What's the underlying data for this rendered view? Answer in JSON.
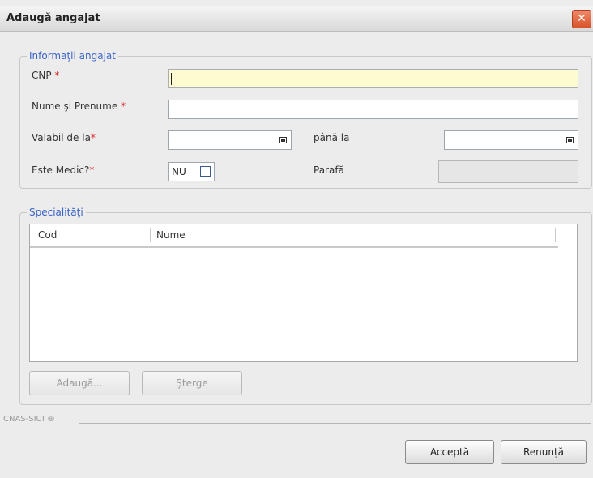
{
  "window": {
    "title": "Adaugă angajat",
    "close_glyph": "✕"
  },
  "employee_info": {
    "legend": "Informaţii angajat",
    "cnp_label": "CNP",
    "cnp_value": "",
    "name_label": "Nume şi Prenume",
    "name_value": "",
    "valid_from_label": "Valabil de la",
    "valid_from_value": "",
    "valid_to_label": "până la",
    "valid_to_value": "",
    "is_medic_label": "Este Medic?",
    "is_medic_value": "NU",
    "is_medic_checked": false,
    "parafa_label": "Parafă",
    "parafa_value": "",
    "required_mark": "*"
  },
  "specialties": {
    "legend": "Specialităţi",
    "columns": [
      "Cod",
      "Nume"
    ],
    "rows": [],
    "add_button": "Adaugă...",
    "delete_button": "Şterge"
  },
  "footer": {
    "brand": "CNAS-SIUI ®",
    "accept_button": "Acceptă",
    "cancel_button": "Renunţă"
  },
  "colors": {
    "accent": "#3a64c8",
    "required": "#e02020",
    "focus_field": "#fffbd1"
  }
}
